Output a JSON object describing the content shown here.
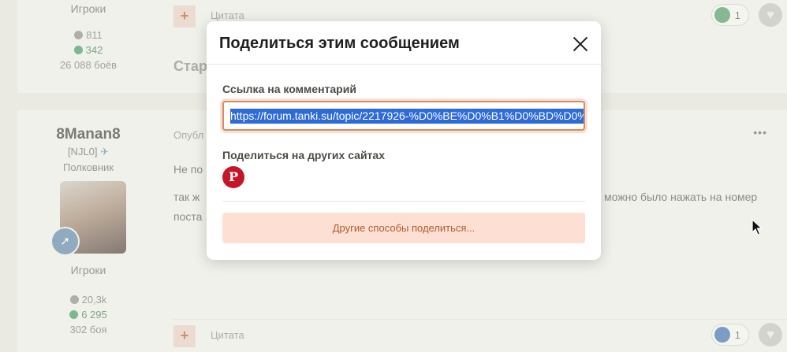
{
  "top_post": {
    "author_role": "Игроки",
    "posts_count": "811",
    "reputation": "342",
    "battles": "26 088 боёв",
    "quote_label": "Цитата",
    "reaction_count": "1",
    "partial_title": "Стар"
  },
  "main_post": {
    "author_name": "8Manan8",
    "clan": "[NJL0]",
    "rank": "Полковник",
    "author_role": "Игроки",
    "posts_count": "20,3k",
    "reputation": "6 295",
    "battles": "302 боя",
    "published_partial": "Опубл",
    "text_line1_partial": "Не по",
    "text_line2_left": "так ж",
    "text_line2_right": "можно было нажать на номер",
    "text_line3_partial": "поста",
    "more_menu": "•••",
    "quote_label": "Цитата",
    "reaction_count": "1"
  },
  "modal": {
    "title": "Поделиться этим сообщением",
    "link_label": "Ссылка на комментарий",
    "link_value": "https://forum.tanki.su/topic/2217926-%D0%BE%D0%B1%D0%BD%D0%",
    "share_label": "Поделиться на других сайтах",
    "pinterest_glyph": "P",
    "more_share_button": "Другие способы поделиться..."
  },
  "colors": {
    "accent": "#d48b66",
    "button_bg": "#fde0d3",
    "button_text": "#b45a2e",
    "pinterest": "#c41628",
    "selection": "#2f6bd7"
  },
  "icons": [
    "close-icon",
    "pinterest-icon",
    "comment-icon",
    "reputation-icon",
    "heart-icon",
    "plus-icon",
    "rocket-icon",
    "mouse-cursor-icon"
  ]
}
